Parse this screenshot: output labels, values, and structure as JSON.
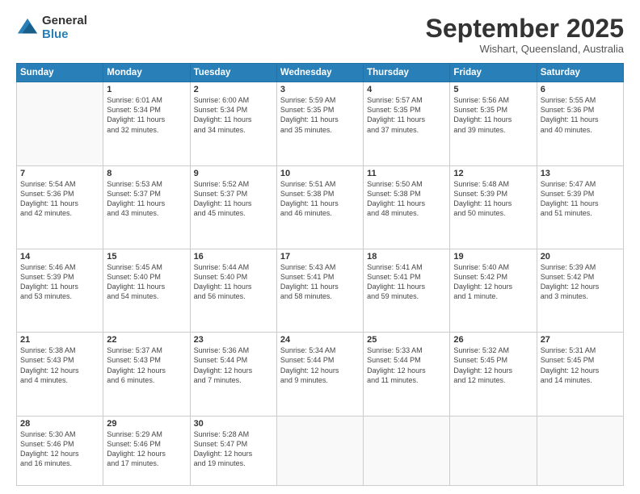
{
  "logo": {
    "general": "General",
    "blue": "Blue"
  },
  "header": {
    "month": "September 2025",
    "location": "Wishart, Queensland, Australia"
  },
  "weekdays": [
    "Sunday",
    "Monday",
    "Tuesday",
    "Wednesday",
    "Thursday",
    "Friday",
    "Saturday"
  ],
  "weeks": [
    [
      {
        "day": "",
        "info": ""
      },
      {
        "day": "1",
        "info": "Sunrise: 6:01 AM\nSunset: 5:34 PM\nDaylight: 11 hours\nand 32 minutes."
      },
      {
        "day": "2",
        "info": "Sunrise: 6:00 AM\nSunset: 5:34 PM\nDaylight: 11 hours\nand 34 minutes."
      },
      {
        "day": "3",
        "info": "Sunrise: 5:59 AM\nSunset: 5:35 PM\nDaylight: 11 hours\nand 35 minutes."
      },
      {
        "day": "4",
        "info": "Sunrise: 5:57 AM\nSunset: 5:35 PM\nDaylight: 11 hours\nand 37 minutes."
      },
      {
        "day": "5",
        "info": "Sunrise: 5:56 AM\nSunset: 5:35 PM\nDaylight: 11 hours\nand 39 minutes."
      },
      {
        "day": "6",
        "info": "Sunrise: 5:55 AM\nSunset: 5:36 PM\nDaylight: 11 hours\nand 40 minutes."
      }
    ],
    [
      {
        "day": "7",
        "info": "Sunrise: 5:54 AM\nSunset: 5:36 PM\nDaylight: 11 hours\nand 42 minutes."
      },
      {
        "day": "8",
        "info": "Sunrise: 5:53 AM\nSunset: 5:37 PM\nDaylight: 11 hours\nand 43 minutes."
      },
      {
        "day": "9",
        "info": "Sunrise: 5:52 AM\nSunset: 5:37 PM\nDaylight: 11 hours\nand 45 minutes."
      },
      {
        "day": "10",
        "info": "Sunrise: 5:51 AM\nSunset: 5:38 PM\nDaylight: 11 hours\nand 46 minutes."
      },
      {
        "day": "11",
        "info": "Sunrise: 5:50 AM\nSunset: 5:38 PM\nDaylight: 11 hours\nand 48 minutes."
      },
      {
        "day": "12",
        "info": "Sunrise: 5:48 AM\nSunset: 5:39 PM\nDaylight: 11 hours\nand 50 minutes."
      },
      {
        "day": "13",
        "info": "Sunrise: 5:47 AM\nSunset: 5:39 PM\nDaylight: 11 hours\nand 51 minutes."
      }
    ],
    [
      {
        "day": "14",
        "info": "Sunrise: 5:46 AM\nSunset: 5:39 PM\nDaylight: 11 hours\nand 53 minutes."
      },
      {
        "day": "15",
        "info": "Sunrise: 5:45 AM\nSunset: 5:40 PM\nDaylight: 11 hours\nand 54 minutes."
      },
      {
        "day": "16",
        "info": "Sunrise: 5:44 AM\nSunset: 5:40 PM\nDaylight: 11 hours\nand 56 minutes."
      },
      {
        "day": "17",
        "info": "Sunrise: 5:43 AM\nSunset: 5:41 PM\nDaylight: 11 hours\nand 58 minutes."
      },
      {
        "day": "18",
        "info": "Sunrise: 5:41 AM\nSunset: 5:41 PM\nDaylight: 11 hours\nand 59 minutes."
      },
      {
        "day": "19",
        "info": "Sunrise: 5:40 AM\nSunset: 5:42 PM\nDaylight: 12 hours\nand 1 minute."
      },
      {
        "day": "20",
        "info": "Sunrise: 5:39 AM\nSunset: 5:42 PM\nDaylight: 12 hours\nand 3 minutes."
      }
    ],
    [
      {
        "day": "21",
        "info": "Sunrise: 5:38 AM\nSunset: 5:43 PM\nDaylight: 12 hours\nand 4 minutes."
      },
      {
        "day": "22",
        "info": "Sunrise: 5:37 AM\nSunset: 5:43 PM\nDaylight: 12 hours\nand 6 minutes."
      },
      {
        "day": "23",
        "info": "Sunrise: 5:36 AM\nSunset: 5:44 PM\nDaylight: 12 hours\nand 7 minutes."
      },
      {
        "day": "24",
        "info": "Sunrise: 5:34 AM\nSunset: 5:44 PM\nDaylight: 12 hours\nand 9 minutes."
      },
      {
        "day": "25",
        "info": "Sunrise: 5:33 AM\nSunset: 5:44 PM\nDaylight: 12 hours\nand 11 minutes."
      },
      {
        "day": "26",
        "info": "Sunrise: 5:32 AM\nSunset: 5:45 PM\nDaylight: 12 hours\nand 12 minutes."
      },
      {
        "day": "27",
        "info": "Sunrise: 5:31 AM\nSunset: 5:45 PM\nDaylight: 12 hours\nand 14 minutes."
      }
    ],
    [
      {
        "day": "28",
        "info": "Sunrise: 5:30 AM\nSunset: 5:46 PM\nDaylight: 12 hours\nand 16 minutes."
      },
      {
        "day": "29",
        "info": "Sunrise: 5:29 AM\nSunset: 5:46 PM\nDaylight: 12 hours\nand 17 minutes."
      },
      {
        "day": "30",
        "info": "Sunrise: 5:28 AM\nSunset: 5:47 PM\nDaylight: 12 hours\nand 19 minutes."
      },
      {
        "day": "",
        "info": ""
      },
      {
        "day": "",
        "info": ""
      },
      {
        "day": "",
        "info": ""
      },
      {
        "day": "",
        "info": ""
      }
    ]
  ]
}
